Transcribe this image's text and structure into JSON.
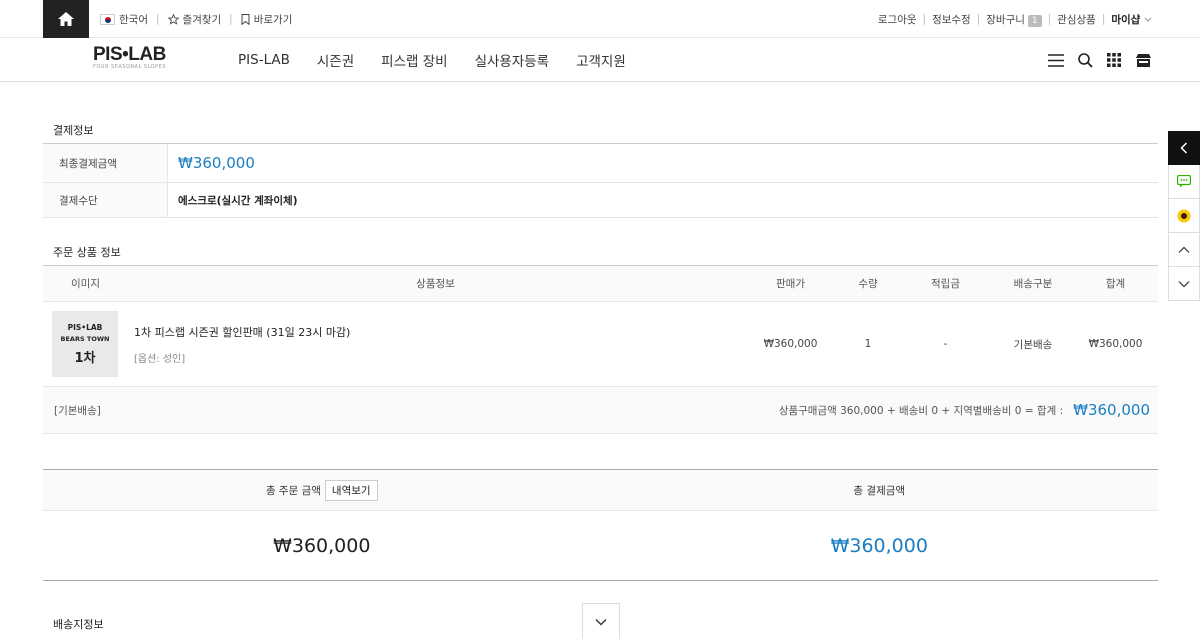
{
  "topbar": {
    "language": "한국어",
    "bookmark": "즐겨찾기",
    "shortcut": "바로가기",
    "logout": "로그아웃",
    "edit_info": "정보수정",
    "cart": "장바구니",
    "cart_count": "1",
    "wishlist": "관심상품",
    "myshop": "마이샵"
  },
  "nav": {
    "logo": "PIS•LAB",
    "logo_sub": "FOUR SEASONAL SLOPES",
    "menu": [
      "PIS-LAB",
      "시즌권",
      "피스랩 장비",
      "실사용자등록",
      "고객지원"
    ]
  },
  "payment": {
    "title": "결제정보",
    "final_label": "최종결제금액",
    "final_value": "₩360,000",
    "method_label": "결제수단",
    "method_value": "에스크로(실시간 계좌이체)"
  },
  "order": {
    "title": "주문 상품 정보",
    "headers": [
      "이미지",
      "상품정보",
      "판매가",
      "수량",
      "적립금",
      "배송구분",
      "합계"
    ],
    "item": {
      "thumb_logo": "PIS•LAB",
      "thumb_sub": "BEARS TOWN",
      "thumb_big": "1차",
      "name": "1차 피스랩 시즌권 할인판매 (31일 23시 마감)",
      "option": "[옵션: 성인]",
      "price": "₩360,000",
      "qty": "1",
      "point": "-",
      "shipping": "기본배송",
      "sum": "₩360,000"
    },
    "footer_left": "[기본배송]",
    "footer_summary": "상품구매금액 360,000 + 배송비 0 + 지역별배송비 0 = 합계 :",
    "footer_total": "₩360,000"
  },
  "totals": {
    "order_label": "총 주문 금액",
    "detail_button": "내역보기",
    "pay_label": "총 결제금액",
    "order_value": "₩360,000",
    "pay_value": "₩360,000"
  },
  "shipping_section": {
    "title": "배송지정보"
  },
  "colors": {
    "accent": "#1b7ec2",
    "dark": "#222222"
  }
}
